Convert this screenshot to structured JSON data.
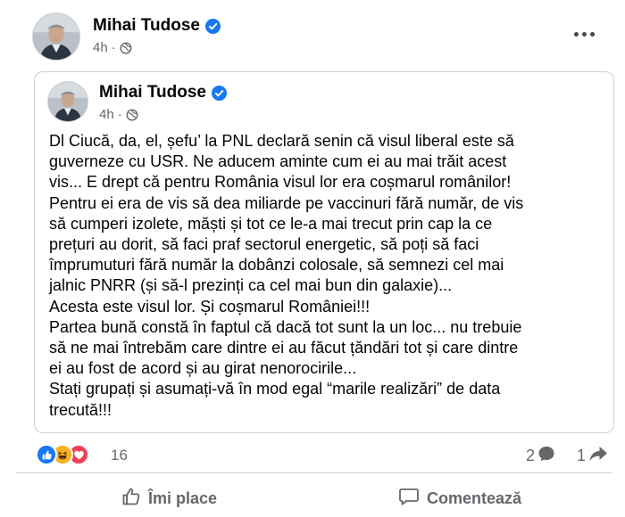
{
  "post": {
    "author": "Mihai Tudose",
    "time": "4h",
    "separator": "·",
    "more_icon": "more-horizontal-icon",
    "shared": {
      "author": "Mihai Tudose",
      "time": "4h",
      "separator": "·",
      "lines": [
        "Dl Ciucă, da, el, șefu’ la PNL declară senin că visul liberal este să",
        "guverneze cu USR. Ne aducem aminte cum ei au mai trăit acest",
        "vis... E drept că pentru România visul lor era coșmarul românilor!",
        "Pentru ei era de vis să dea miliarde pe vaccinuri fără număr, de vis",
        "să cumperi izolete, măști și tot ce le-a mai trecut prin cap la ce",
        "prețuri au dorit, să faci praf sectorul energetic, să poți să faci",
        "împrumuturi fără număr la dobânzi colosale, să semnezi cel mai",
        "jalnic PNRR (și să-l prezinți ca cel mai bun din galaxie)...",
        "Acesta este visul lor. Și coșmarul României!!!",
        "Partea bună constă în faptul că dacă tot sunt la un loc... nu trebuie",
        "să ne mai întrebăm care dintre ei au făcut țăndări tot și care dintre",
        "ei au fost de acord și au girat nenorocirile...",
        "Stați grupați și asumați-vă în mod egal “marile realizări” de data",
        "trecută!!!"
      ]
    },
    "reactions": {
      "icons": [
        "like-reaction-icon",
        "haha-reaction-icon",
        "love-reaction-icon"
      ],
      "count": "16"
    },
    "comments_count": "2",
    "shares_count": "1",
    "actions": {
      "like_label": "Îmi place",
      "comment_label": "Comentează"
    }
  },
  "colors": {
    "verified_blue": "#1877f2",
    "secondary_text": "#65676b",
    "love_red": "#f33e58",
    "haha_yellow": "#f7b125"
  }
}
